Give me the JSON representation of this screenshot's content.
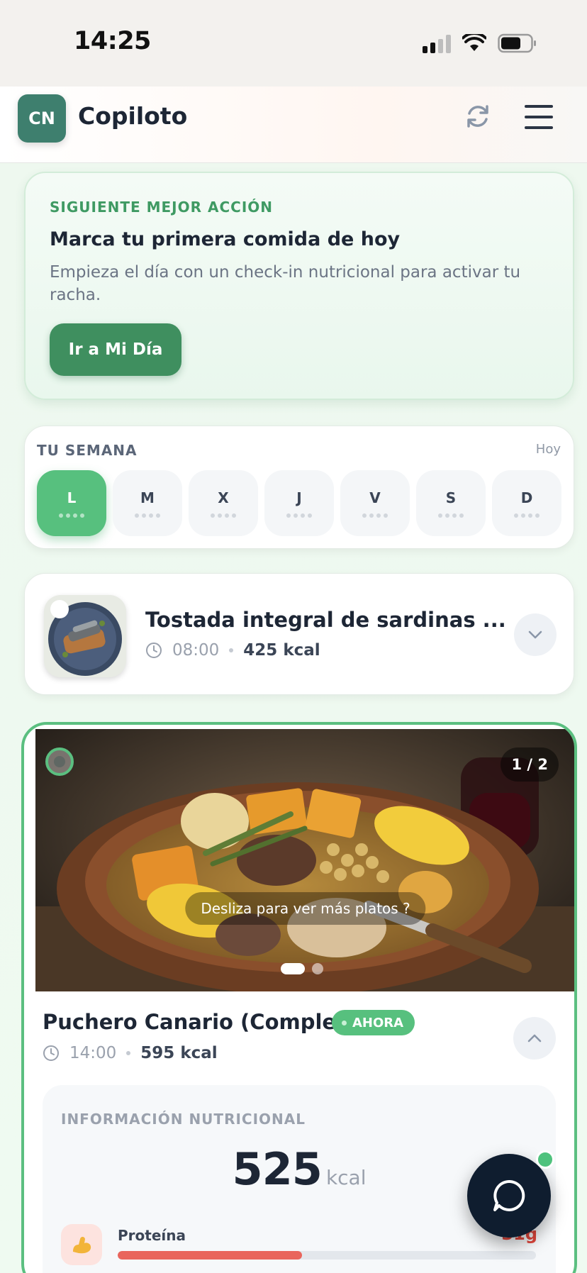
{
  "status_bar": {
    "time": "14:25"
  },
  "header": {
    "avatar_initials": "CN",
    "title": "Copiloto"
  },
  "next_action": {
    "eyebrow": "SIGUIENTE MEJOR ACCIÓN",
    "title": "Marca tu primera comida de hoy",
    "description": "Empieza el día con un check-in nutricional para activar tu racha.",
    "button_label": "Ir a Mi Día"
  },
  "week": {
    "title": "TU SEMANA",
    "today_label": "Hoy",
    "days": [
      {
        "label": "L",
        "active": true
      },
      {
        "label": "M",
        "active": false
      },
      {
        "label": "X",
        "active": false
      },
      {
        "label": "J",
        "active": false
      },
      {
        "label": "V",
        "active": false
      },
      {
        "label": "S",
        "active": false
      },
      {
        "label": "D",
        "active": false
      }
    ]
  },
  "meals": [
    {
      "title": "Tostada integral de sardinas ...",
      "time": "08:00",
      "kcal": "425 kcal"
    },
    {
      "title": "Puchero Canario (Completo)",
      "badge": "AHORA",
      "time": "14:00",
      "kcal": "595 kcal",
      "gallery_counter": "1 / 2",
      "swipe_hint": "Desliza para ver más platos ?",
      "nutrition": {
        "title": "INFORMACIÓN NUTRICIONAL",
        "kcal_value": "525",
        "kcal_unit": "kcal",
        "macros": [
          {
            "label": "Proteína",
            "value": "31g",
            "icon": "flexed-biceps-icon",
            "progress_fraction": 0.44
          }
        ]
      }
    }
  ],
  "colors": {
    "accent_green": "#57c07e",
    "primary_dark_green": "#3f8f5f",
    "protein_red": "#e9655c",
    "chat_fab": "#0f1d2f"
  }
}
